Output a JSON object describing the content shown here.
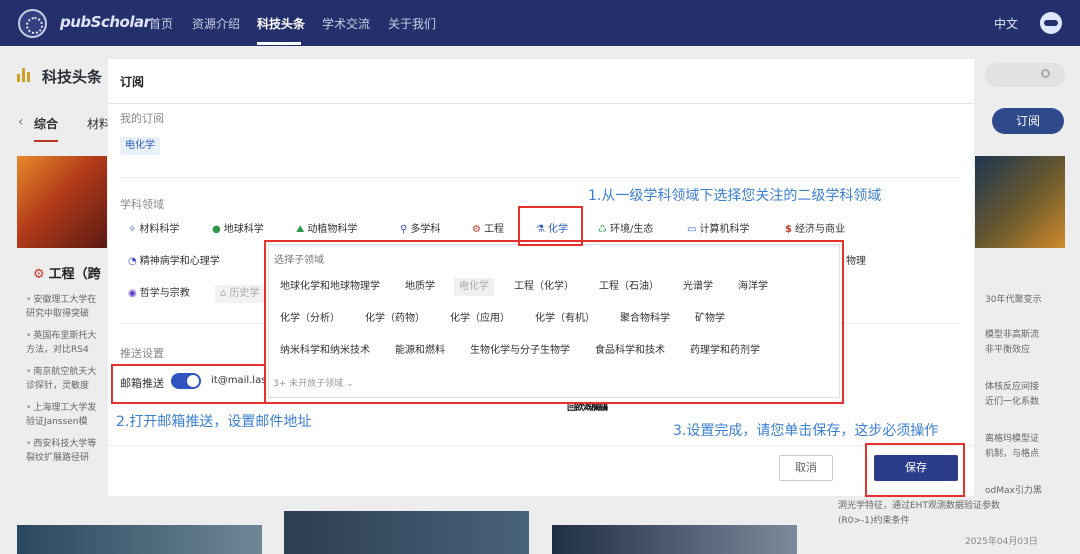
{
  "nav": {
    "logo": "pubScholar",
    "items": [
      "首页",
      "资源介绍",
      "科技头条",
      "学术交流",
      "关于我们"
    ],
    "active": "科技头条",
    "lang": "中文"
  },
  "page": {
    "title": "科技头条",
    "tabs": [
      "综合",
      "材料"
    ],
    "subscribe_button": "订阅",
    "left_heading": "工程（跨",
    "left_lines": [
      "安徽理工大学在",
      "研究中取得突破",
      "英国布里斯托大",
      "方法，对比RS4",
      "南京航空航天大",
      "诊探针，灵敏度",
      "上海理工大学发",
      "验证Janssen模",
      "西安科技大学等",
      "裂纹扩展路径研"
    ],
    "right_lines": [
      "30年代聚变示",
      "模型非高斯流",
      "非平衡效应",
      "体核反应间接",
      "近们一化系数",
      "离格玛模型证",
      "机制，与格点",
      "odMax引力黑",
      "洞光学特征，通过EHT观测数据验证参数",
      "(R0>-1)约束条件"
    ],
    "right_date": "2025年04月03日"
  },
  "modal": {
    "title": "订阅",
    "my_subs_label": "我的订阅",
    "my_subs": [
      "电化学"
    ],
    "fields_label": "学科领域",
    "fields": [
      {
        "label": "材料科学",
        "icon": "atom-icon",
        "glyph": "✧"
      },
      {
        "label": "地球科学",
        "icon": "globe-icon",
        "glyph": "●"
      },
      {
        "label": "动植物科学",
        "icon": "plant-icon",
        "glyph": "⛰"
      },
      {
        "label": "多学科",
        "icon": "magnifier-icon",
        "glyph": "⚲"
      },
      {
        "label": "工程",
        "icon": "engineering-icon",
        "glyph": "⚙"
      },
      {
        "label": "化学",
        "icon": "flask-icon",
        "glyph": "⚗"
      },
      {
        "label": "环境/生态",
        "icon": "recycle-icon",
        "glyph": "♺"
      },
      {
        "label": "计算机科学",
        "icon": "computer-icon",
        "glyph": "▭"
      },
      {
        "label": "经济与商业",
        "icon": "dollar-icon",
        "glyph": "$"
      },
      {
        "label": "精神病学和心理学",
        "icon": "brain-icon",
        "glyph": "◔"
      },
      {
        "label": "物理",
        "icon": "",
        "glyph": ""
      },
      {
        "label": "哲学与宗教",
        "icon": "philosophy-icon",
        "glyph": "◉"
      },
      {
        "label": "历史学",
        "icon": "museum-icon",
        "glyph": "⌂"
      }
    ],
    "push_label": "推送设置",
    "email_push_label": "邮箱推送",
    "email_value": "it@mail.las",
    "cancel": "取消",
    "save": "保存"
  },
  "popover": {
    "title": "选择子领域",
    "row1": [
      "地球化学和地球物理学",
      "地质学",
      "电化学",
      "工程（化学）",
      "工程（石油）",
      "光谱学",
      "海洋学"
    ],
    "row2": [
      "化学（分析）",
      "化学（药物）",
      "化学（应用）",
      "化学（有机）",
      "聚合物科学",
      "矿物学"
    ],
    "row3": [
      "纳米科学和纳米技术",
      "能源和燃料",
      "生物化学与分子生物学",
      "食品科学和技术",
      "药理学和药剂学"
    ],
    "footer": "3+ 未开放子领域"
  },
  "annotations": {
    "a1": "1.从一级学科领域下选择您关注的二级学科领域",
    "a2": "2.打开邮箱推送，设置邮件地址",
    "a3": "3.设置完成，请您单击保存，这步必须操作"
  },
  "qr_caption": "回欲溉欄鷂",
  "colors": {
    "nav_bg": "#24306b",
    "primary": "#2b3c8a",
    "annotation_box": "#e5312b",
    "annotation_text": "#3b7fd3"
  }
}
